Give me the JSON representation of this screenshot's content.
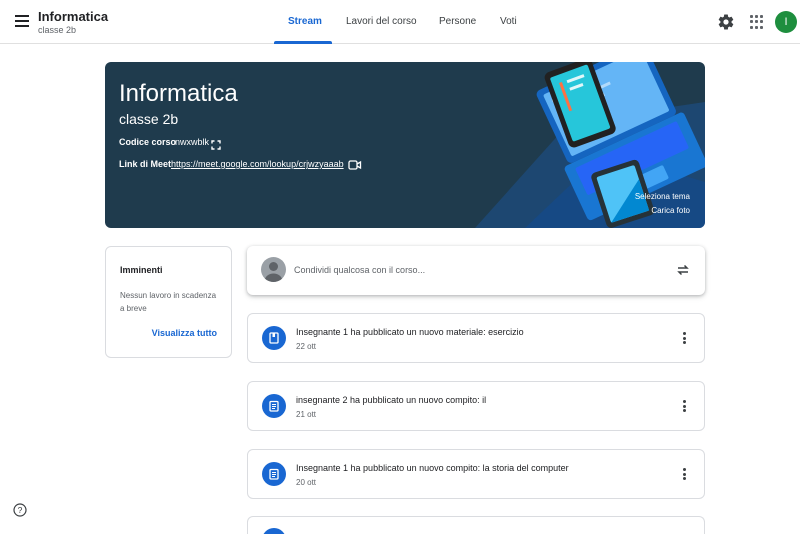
{
  "header": {
    "class_name": "Informatica",
    "class_section": "classe 2b",
    "tabs": [
      {
        "label": "Stream",
        "active": true
      },
      {
        "label": "Lavori del corso",
        "active": false
      },
      {
        "label": "Persone",
        "active": false
      },
      {
        "label": "Voti",
        "active": false
      }
    ],
    "user_initial": "I",
    "icons": [
      "menu-icon",
      "gear-icon",
      "apps-grid-icon"
    ]
  },
  "banner": {
    "title": "Informatica",
    "subtitle": "classe 2b",
    "code_label": "Codice corso",
    "code_value": "nwxwblk",
    "meet_label": "Link di Meet",
    "meet_link": "https://meet.google.com/lookup/crjwzyaaab",
    "select_theme": "Seleziona tema",
    "upload_photo": "Carica foto",
    "background_color": "#1f3b4d"
  },
  "upcoming": {
    "title": "Imminenti",
    "empty_text": "Nessun lavoro in scadenza a breve",
    "view_all": "Visualizza tutto"
  },
  "share": {
    "placeholder": "Condividi qualcosa con il corso..."
  },
  "stream": [
    {
      "title": "Insegnante 1 ha pubblicato un nuovo materiale: esercizio",
      "date": "22 ott",
      "icon": "material-icon"
    },
    {
      "title": "insegnante 2 ha pubblicato un nuovo compito: il",
      "date": "21 ott",
      "icon": "assignment-icon"
    },
    {
      "title": "Insegnante 1 ha pubblicato un nuovo compito: la storia del computer",
      "date": "20 ott",
      "icon": "assignment-icon"
    }
  ],
  "colors": {
    "accent": "#1967d2",
    "avatar": "#1e8e3e"
  }
}
